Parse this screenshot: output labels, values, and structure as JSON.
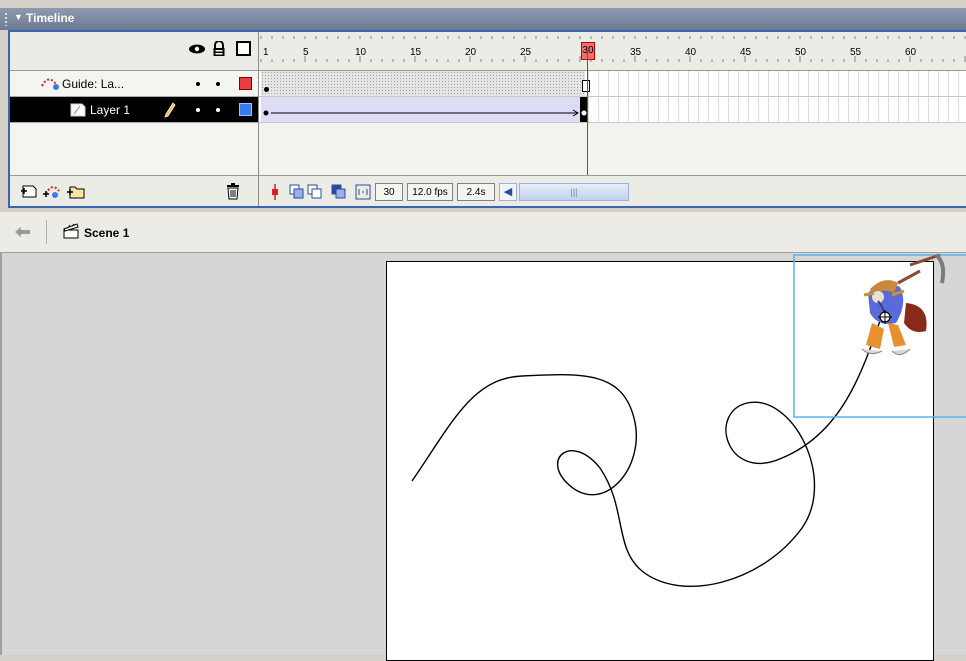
{
  "panel": {
    "title": "Timeline"
  },
  "layers": [
    {
      "name": "Guide: La...",
      "type": "guide",
      "color": "#e84040"
    },
    {
      "name": "Layer 1",
      "type": "normal",
      "color": "#3a7af0",
      "selected": true
    }
  ],
  "ruler": {
    "labels": [
      "1",
      "5",
      "10",
      "15",
      "20",
      "25",
      "30",
      "35",
      "40",
      "45",
      "50",
      "55",
      "60"
    ]
  },
  "status": {
    "current_frame": "30",
    "frame_rate": "12.0 fps",
    "elapsed_time": "2.4s"
  },
  "playhead_frame": "30",
  "scene": {
    "name": "Scene 1"
  },
  "icons": {
    "eye": "eye-icon",
    "lock": "lock-icon",
    "outline": "outline-icon",
    "trash": "trash-icon",
    "back": "back-arrow-icon",
    "scene": "scene-clapper-icon"
  },
  "colors": {
    "accent": "#3c64b0",
    "playhead": "#f07070",
    "selected_row": "#000000",
    "bounding_box": "#5ab4e8"
  }
}
